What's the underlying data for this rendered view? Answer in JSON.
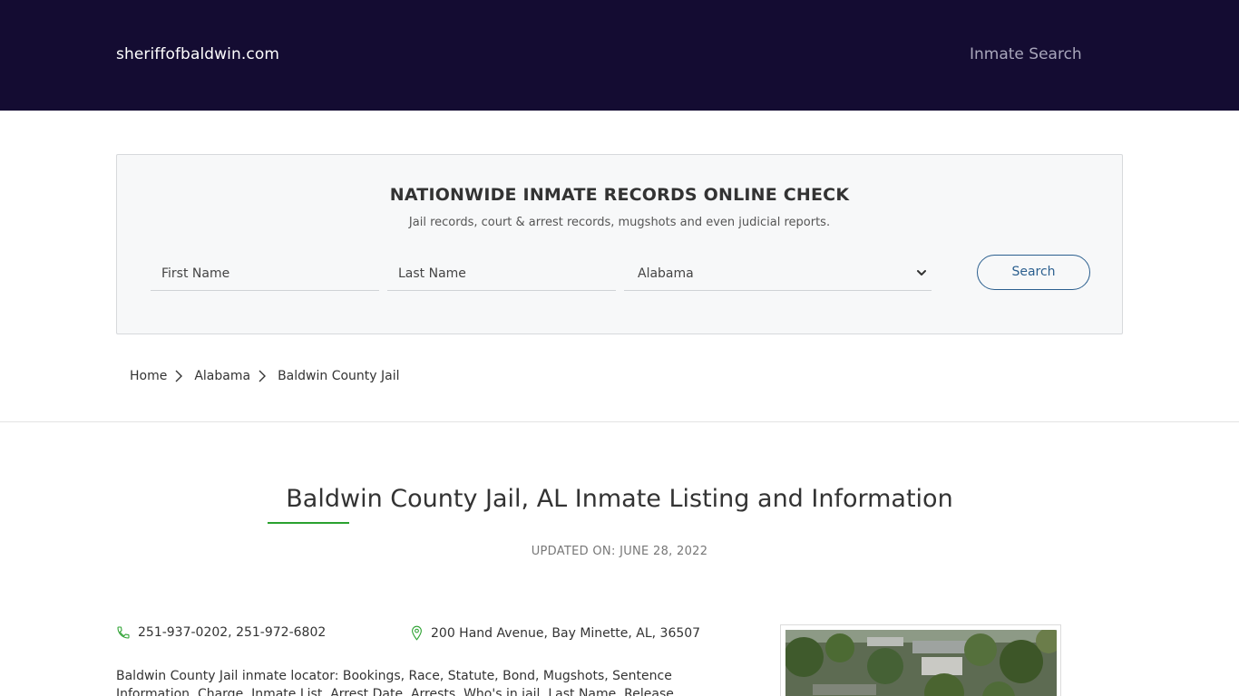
{
  "header": {
    "brand": "sheriffofbaldwin.com",
    "nav_link": "Inmate Search"
  },
  "search_panel": {
    "title": "NATIONWIDE INMATE RECORDS ONLINE CHECK",
    "subtitle": "Jail records, court & arrest records, mugshots and even judicial reports.",
    "first_name_placeholder": "First Name",
    "last_name_placeholder": "Last Name",
    "state_selected": "Alabama",
    "search_button": "Search"
  },
  "breadcrumb": [
    "Home",
    "Alabama",
    "Baldwin County Jail"
  ],
  "page": {
    "title": "Baldwin County Jail, AL Inmate Listing and Information",
    "updated": "UPDATED ON: JUNE 28, 2022",
    "phone": "251-937-0202, 251-972-6802",
    "address": "200 Hand Avenue, Bay Minette, AL, 36507",
    "description": "Baldwin County Jail inmate locator: Bookings, Race, Statute, Bond, Mugshots, Sentence Information, Charge, Inmate List, Arrest Date, Arrests, Who's in jail, Last Name, Release"
  },
  "colors": {
    "header_bg": "#140c32",
    "accent_green": "#2aa12f",
    "button_blue": "#2b5f8f"
  },
  "icons": [
    "phone-icon",
    "map-pin-icon",
    "chevron-right-icon",
    "chevron-down-icon"
  ]
}
